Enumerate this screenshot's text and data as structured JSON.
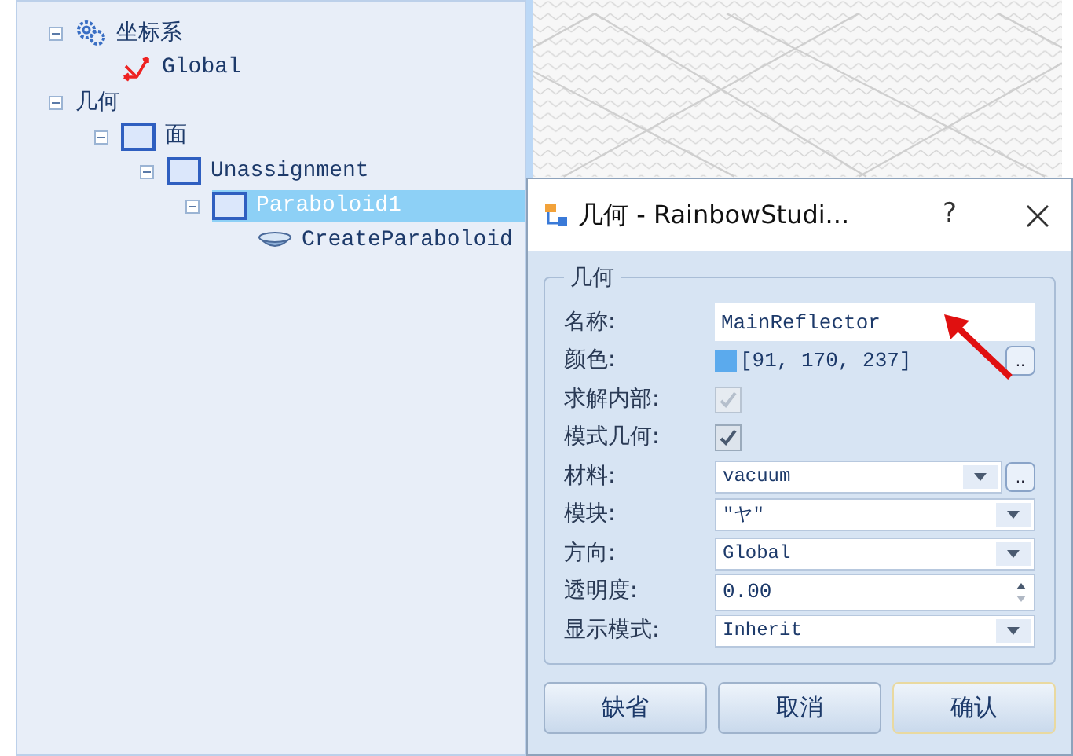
{
  "tree": [
    {
      "label": "坐标系",
      "kind": "gear",
      "expanded": true,
      "selected": false,
      "children": [
        {
          "label": "Global",
          "kind": "axes",
          "selected": false
        }
      ]
    },
    {
      "label": "几何",
      "kind": "group",
      "expanded": true,
      "selected": false,
      "children": [
        {
          "label": "面",
          "kind": "square",
          "expanded": true,
          "selected": false,
          "children": [
            {
              "label": "Unassignment",
              "kind": "square",
              "expanded": true,
              "selected": false,
              "children": [
                {
                  "label": "Paraboloid1",
                  "kind": "square",
                  "expanded": true,
                  "selected": true,
                  "children": [
                    {
                      "label": "CreateParaboloid",
                      "kind": "dish",
                      "selected": false
                    }
                  ]
                }
              ]
            }
          ]
        }
      ]
    }
  ],
  "dialog": {
    "title": "几何 - RainbowStudi...",
    "help": "?",
    "group": "几何",
    "fields": [
      {
        "kind": "text",
        "label": "名称:",
        "value": "MainReflector"
      },
      {
        "kind": "color",
        "label": "颜色:",
        "value": "[91, 170, 237]",
        "color": "#5baaed",
        "button": ".."
      },
      {
        "kind": "checkbox",
        "label": "求解内部:",
        "checked": true,
        "disabled": true
      },
      {
        "kind": "checkbox",
        "label": "模式几何:",
        "checked": true,
        "disabled": false
      },
      {
        "kind": "dropdown",
        "label": "材料:",
        "value": "vacuum",
        "button": ".."
      },
      {
        "kind": "dropdown",
        "label": "模块:",
        "value": "\"ヤ\""
      },
      {
        "kind": "dropdown",
        "label": "方向:",
        "value": "Global"
      },
      {
        "kind": "spinner",
        "label": "透明度:",
        "value": "0.00"
      },
      {
        "kind": "dropdown",
        "label": "显示模式:",
        "value": "Inherit"
      }
    ],
    "buttons": [
      {
        "label": "缺省",
        "focused": false
      },
      {
        "label": "取消",
        "focused": false
      },
      {
        "label": "确认",
        "focused": true
      }
    ]
  }
}
